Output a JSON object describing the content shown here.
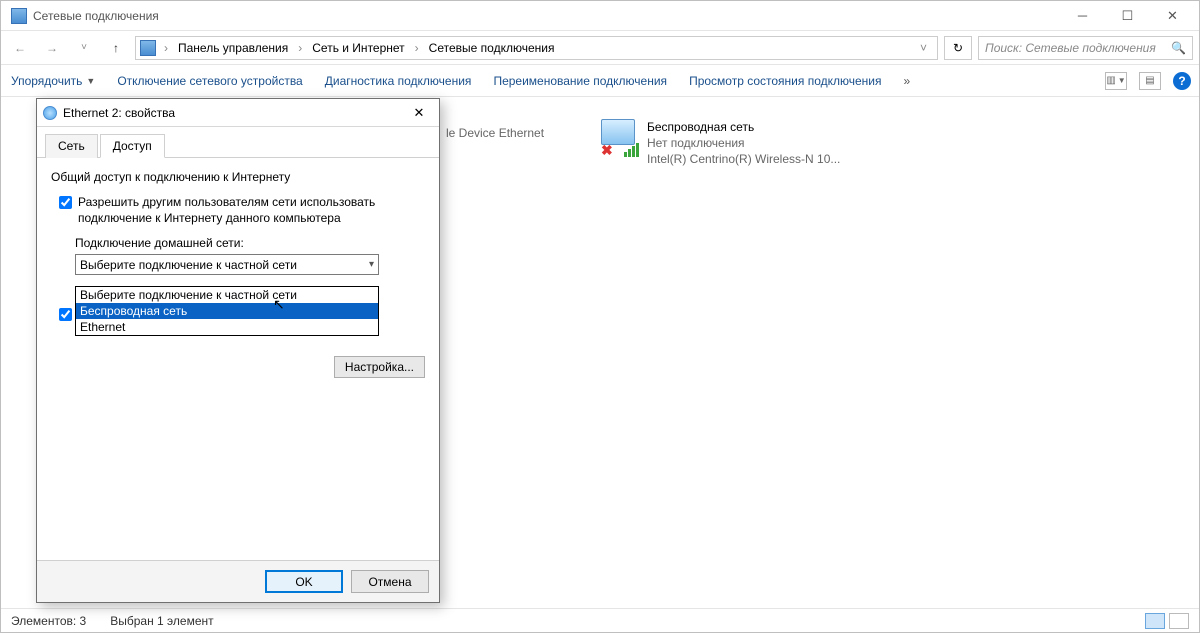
{
  "window": {
    "title": "Сетевые подключения",
    "search_placeholder": "Поиск: Сетевые подключения"
  },
  "breadcrumb": {
    "seg1": "Панель управления",
    "seg2": "Сеть и Интернет",
    "seg3": "Сетевые подключения"
  },
  "toolbar": {
    "organize": "Упорядочить",
    "disable": "Отключение сетевого устройства",
    "diagnose": "Диагностика подключения",
    "rename": "Переименование подключения",
    "status": "Просмотр состояния подключения"
  },
  "connections": {
    "eth_partial": {
      "device_line": "le Device Ethernet"
    },
    "wifi": {
      "name": "Беспроводная сеть",
      "status": "Нет подключения",
      "device": "Intel(R) Centrino(R) Wireless-N 10..."
    }
  },
  "statusbar": {
    "elements": "Элементов: 3",
    "selected": "Выбран 1 элемент"
  },
  "dialog": {
    "title": "Ethernet 2: свойства",
    "tab_network": "Сеть",
    "tab_sharing": "Доступ",
    "group": "Общий доступ к подключению к Интернету",
    "allow_label": "Разрешить другим пользователям сети использовать подключение к Интернету данного компьютера",
    "homenet_label": "Подключение домашней сети:",
    "combo_value": "Выберите подключение к частной сети",
    "options": {
      "o0": "Выберите подключение к частной сети",
      "o1": "Беспроводная сеть",
      "o2": "Ethernet"
    },
    "settings_btn": "Настройка...",
    "ok": "OK",
    "cancel": "Отмена"
  }
}
